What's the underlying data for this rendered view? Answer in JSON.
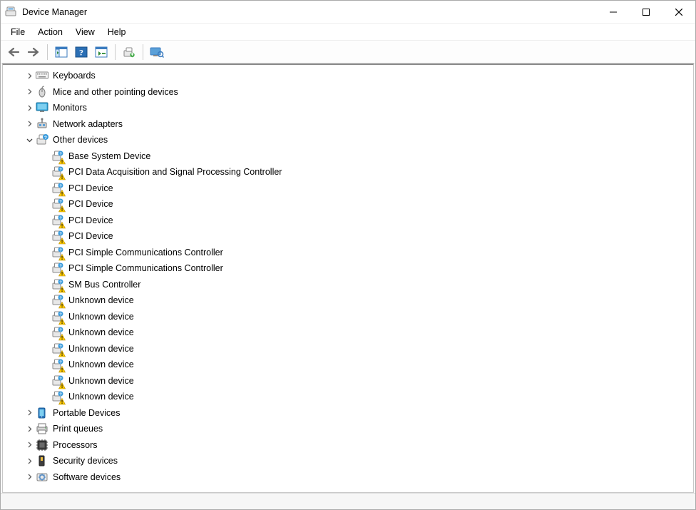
{
  "window": {
    "title": "Device Manager"
  },
  "menu": {
    "file": "File",
    "action": "Action",
    "view": "View",
    "help": "Help"
  },
  "toolbar_icons": {
    "back": "back-arrow",
    "forward": "forward-arrow",
    "show_hide": "show-hide-console-tree",
    "help": "help",
    "properties": "properties",
    "update": "update-driver",
    "scan": "scan-hardware"
  },
  "tree": [
    {
      "label": "Keyboards",
      "icon": "keyboard",
      "expandable": true,
      "expanded": false
    },
    {
      "label": "Mice and other pointing devices",
      "icon": "mouse",
      "expandable": true,
      "expanded": false
    },
    {
      "label": "Monitors",
      "icon": "monitor",
      "expandable": true,
      "expanded": false
    },
    {
      "label": "Network adapters",
      "icon": "network",
      "expandable": true,
      "expanded": false
    },
    {
      "label": "Other devices",
      "icon": "other",
      "expandable": true,
      "expanded": true,
      "children": [
        {
          "label": "Base System Device",
          "icon": "unknown",
          "warn": true
        },
        {
          "label": "PCI Data Acquisition and Signal Processing Controller",
          "icon": "unknown",
          "warn": true
        },
        {
          "label": "PCI Device",
          "icon": "unknown",
          "warn": true
        },
        {
          "label": "PCI Device",
          "icon": "unknown",
          "warn": true
        },
        {
          "label": "PCI Device",
          "icon": "unknown",
          "warn": true
        },
        {
          "label": "PCI Device",
          "icon": "unknown",
          "warn": true
        },
        {
          "label": "PCI Simple Communications Controller",
          "icon": "unknown",
          "warn": true
        },
        {
          "label": "PCI Simple Communications Controller",
          "icon": "unknown",
          "warn": true
        },
        {
          "label": "SM Bus Controller",
          "icon": "unknown",
          "warn": true
        },
        {
          "label": "Unknown device",
          "icon": "unknown",
          "warn": true
        },
        {
          "label": "Unknown device",
          "icon": "unknown",
          "warn": true
        },
        {
          "label": "Unknown device",
          "icon": "unknown",
          "warn": true
        },
        {
          "label": "Unknown device",
          "icon": "unknown",
          "warn": true
        },
        {
          "label": "Unknown device",
          "icon": "unknown",
          "warn": true
        },
        {
          "label": "Unknown device",
          "icon": "unknown",
          "warn": true
        },
        {
          "label": "Unknown device",
          "icon": "unknown",
          "warn": true
        }
      ]
    },
    {
      "label": "Portable Devices",
      "icon": "portable",
      "expandable": true,
      "expanded": false
    },
    {
      "label": "Print queues",
      "icon": "printer",
      "expandable": true,
      "expanded": false
    },
    {
      "label": "Processors",
      "icon": "processor",
      "expandable": true,
      "expanded": false
    },
    {
      "label": "Security devices",
      "icon": "security",
      "expandable": true,
      "expanded": false
    },
    {
      "label": "Software devices",
      "icon": "software",
      "expandable": true,
      "expanded": false
    }
  ]
}
